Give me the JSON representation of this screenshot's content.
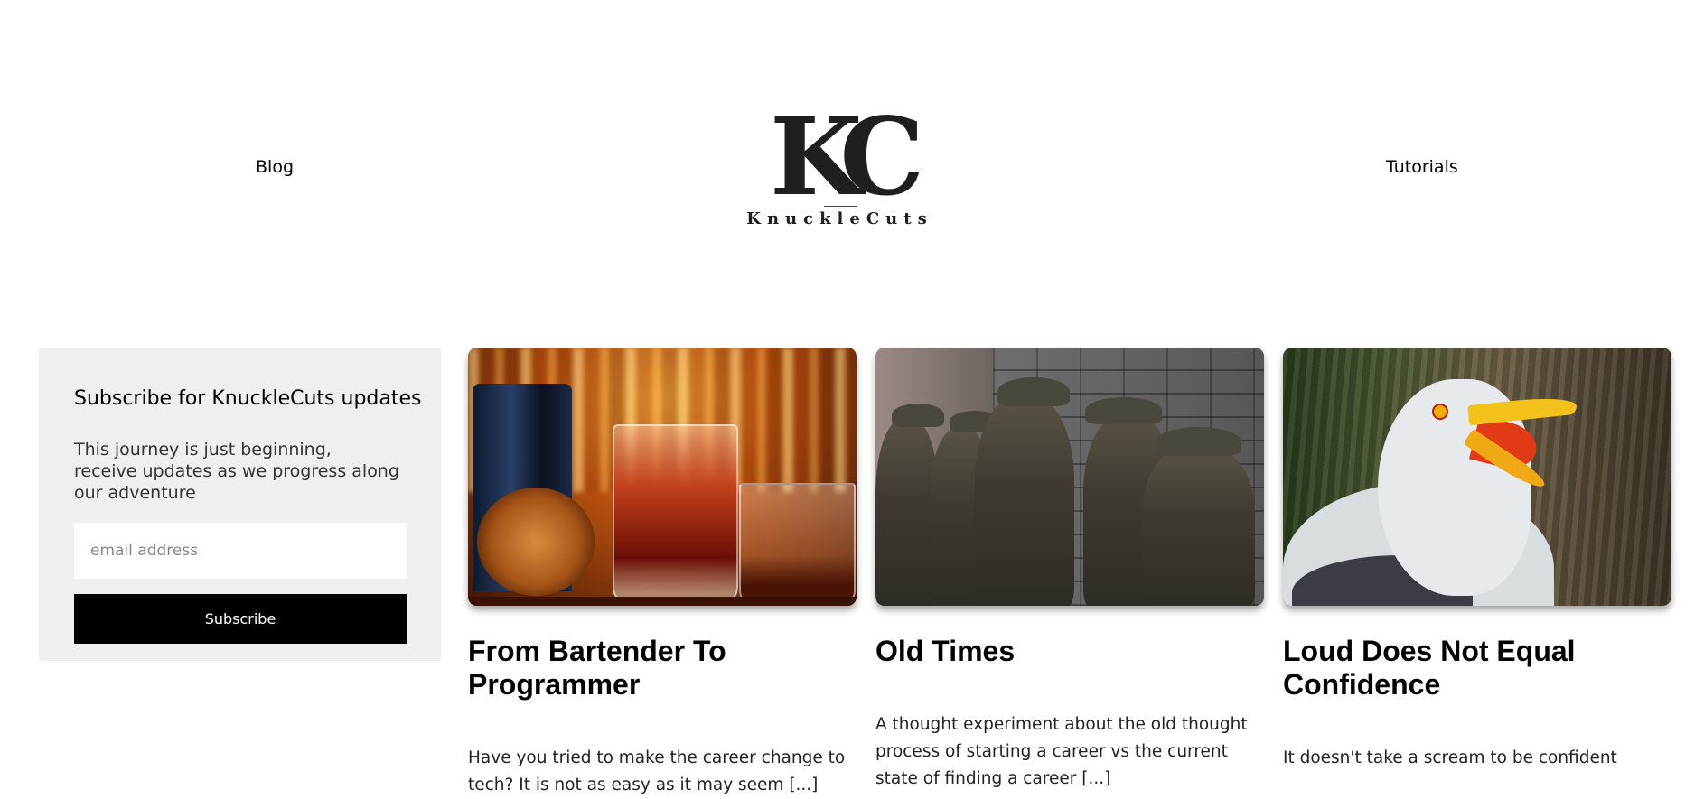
{
  "header": {
    "nav_left": "Blog",
    "nav_right": "Tutorials",
    "logo_mark": "KC",
    "logo_word": "KnuckleCuts"
  },
  "subscribe": {
    "title": "Subscribe for KnuckleCuts updates",
    "description": "This journey is just beginning, receive updates as we progress along our adventure",
    "email_placeholder": "email address",
    "button_label": "Subscribe"
  },
  "posts": [
    {
      "image": "bar-cocktail-image",
      "title": "From Bartender To Programmer",
      "excerpt": "Have you tried to make the career change to tech? It is not as easy as it may seem [...]"
    },
    {
      "image": "breadline-statues-image",
      "title": "Old Times",
      "excerpt": "A thought experiment about the old thought process of starting a career vs the current state of finding a career [...]"
    },
    {
      "image": "screaming-seagull-image",
      "title": "Loud Does Not Equal Confidence",
      "excerpt": "It doesn't take a scream to be confident"
    }
  ],
  "colors": {
    "subscribe_bg": "#efefef",
    "button_bg": "#000000",
    "text": "#000000"
  }
}
